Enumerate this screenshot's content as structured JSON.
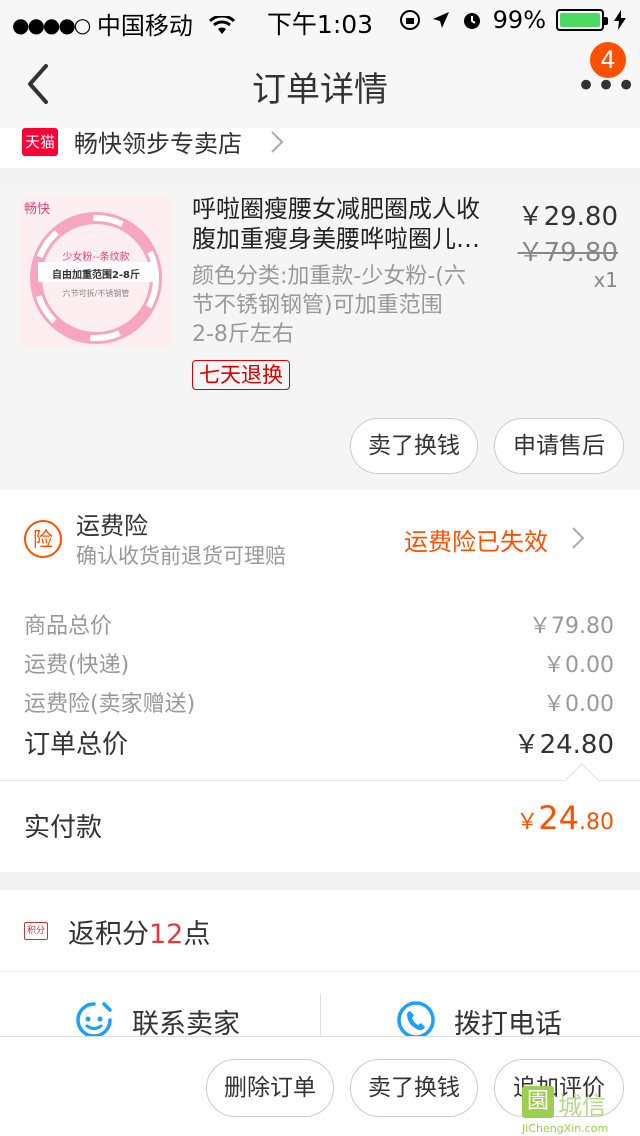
{
  "status_bar": {
    "signal_dots": "●●●●○",
    "carrier": "中国移动",
    "time": "下午1:03",
    "battery": "99%",
    "battery_level": 0.99
  },
  "nav": {
    "title": "订单详情",
    "badge_count": "4"
  },
  "store": {
    "badge": "天猫",
    "name": "畅快领步专卖店"
  },
  "product": {
    "thumb_brand": "畅快",
    "thumb_line1": "少女粉--条纹款",
    "thumb_line2": "自由加重范围2-8斤",
    "thumb_line3": "六节可拆/不锈钢管",
    "title_line1": "呼啦圈瘦腰女减肥圈成人收",
    "title_line2": "腹加重瘦身美腰哗啦圈儿…",
    "price": "￥29.80",
    "original_price": "￥79.80",
    "quantity": "x1",
    "sku_line1": "颜色分类:加重款-少女粉-(六",
    "sku_line2": "节不锈钢钢管)可加重范围",
    "sku_line3": "2-8斤左右",
    "tag": "七天退换",
    "sell_button": "卖了换钱",
    "after_sale_button": "申请售后"
  },
  "insurance": {
    "icon_char": "险",
    "title": "运费险",
    "subtitle": "确认收货前退货可理赔",
    "status": "运费险已失效"
  },
  "summary": {
    "rows": [
      {
        "label": "商品总价",
        "value": "￥79.80"
      },
      {
        "label": "运费(快递)",
        "value": "￥0.00"
      },
      {
        "label": "运费险(卖家赠送)",
        "value": "￥0.00"
      }
    ],
    "total_label": "订单总价",
    "total_value": "￥24.80",
    "paid_label": "实付款",
    "paid_currency": "￥",
    "paid_int": "24",
    "paid_dec": ".80"
  },
  "points": {
    "icon_text": "积分",
    "prefix": "返积分",
    "number": "12",
    "suffix": "点"
  },
  "contact": {
    "seller": "联系卖家",
    "phone": "拨打电话"
  },
  "bottom": {
    "delete": "删除订单",
    "sell": "卖了换钱",
    "review": "追加评价"
  },
  "watermark": {
    "box": "園",
    "text": "城信",
    "url": "JiChengXin.com"
  },
  "colors": {
    "accent": "#ff5000",
    "tmall_red": "#ff0036",
    "battery_green": "#4cd964"
  }
}
